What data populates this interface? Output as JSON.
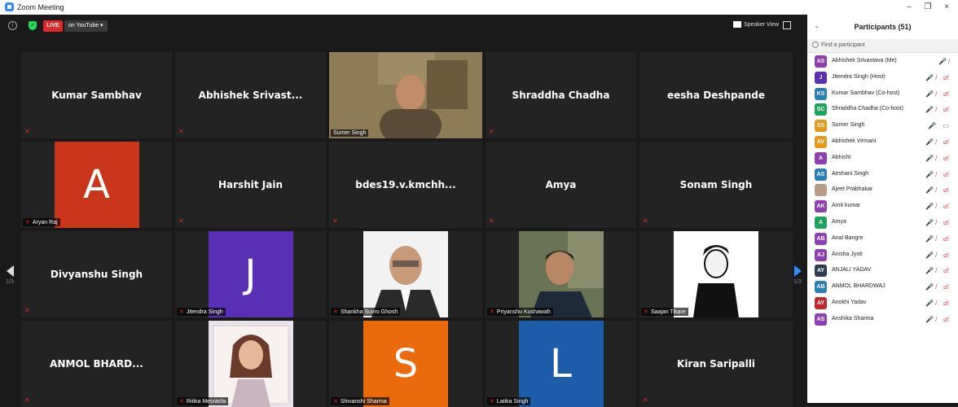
{
  "window": {
    "title": "Zoom Meeting",
    "minimize": "–",
    "restore": "❐",
    "close": "×"
  },
  "topbar": {
    "live": "LIVE",
    "stream": "on YouTube ▾",
    "speaker_view": "Speaker View"
  },
  "tiles": [
    {
      "name": "Kumar Sambhav",
      "muted": true
    },
    {
      "name": "Abhishek  Srivast...",
      "muted": true
    },
    {
      "label": "Sumer Singh",
      "type": "video",
      "active": true
    },
    {
      "name": "Shraddha Chadha",
      "muted": true
    },
    {
      "name": "eesha Deshpande",
      "muted": false
    },
    {
      "label": "Aryan Raj",
      "letter": "A",
      "color": "#c9361a"
    },
    {
      "name": "Harshit Jain",
      "muted": true
    },
    {
      "name": "bdes19.v.kmchh...",
      "muted": true
    },
    {
      "name": "Amya",
      "muted": true
    },
    {
      "name": "Sonam Singh",
      "muted": true
    },
    {
      "name": "Divyanshu Singh",
      "muted": true
    },
    {
      "label": "Jitendra Singh",
      "letter": "J",
      "color": "#5b2fb5"
    },
    {
      "label": "Shankha Suvro Ghosh",
      "type": "photo"
    },
    {
      "label": "Priyanshu Kushawah",
      "type": "photo"
    },
    {
      "label": "Saajan Tikare",
      "type": "photo"
    },
    {
      "name": "ANMOL  BHARD...",
      "muted": true
    },
    {
      "label": "Ritika Mesracta",
      "type": "photo"
    },
    {
      "label": "Shivanshi Sharma",
      "letter": "S",
      "color": "#ea6a0c"
    },
    {
      "label": "Latika Singh",
      "letter": "L",
      "color": "#1d5ca8"
    },
    {
      "name": "Kiran Saripalli",
      "muted": true
    }
  ],
  "nav": {
    "left_page": "1/3",
    "right_page": "1/3"
  },
  "participants": {
    "title": "Participants (51)",
    "search_placeholder": "Find a participant",
    "items": [
      {
        "initials": "AS",
        "name": "Abhishek Srivastava (Me)",
        "color": "#8e3fb1",
        "icons": "🎤̸"
      },
      {
        "initials": "J",
        "name": "Jitendra Singh (Host)",
        "color": "#5b2fb5",
        "icons": "🎤̸ ▭̸"
      },
      {
        "initials": "KS",
        "name": "Kumar Sambhav (Co-host)",
        "color": "#2a7fb8",
        "icons": "🎤̸ ▭̸"
      },
      {
        "initials": "SC",
        "name": "Shraddha Chadha (Co-host)",
        "color": "#1fa35a",
        "icons": "🎤̸ ▭̸"
      },
      {
        "initials": "SS",
        "name": "Sumer Singh",
        "color": "#e39a1c",
        "icons": "🎤 ▭"
      },
      {
        "initials": "AV",
        "name": "Abhishek Virmani",
        "color": "#e39a1c",
        "icons": "🎤̸ ▭̸"
      },
      {
        "initials": "A",
        "name": "Abhisht",
        "color": "#8e3fb1",
        "icons": "🎤̸ ▭̸"
      },
      {
        "initials": "AS",
        "name": "Aeshani Singh",
        "color": "#2a7fb8",
        "icons": "🎤̸ ▭̸"
      },
      {
        "initials": "",
        "name": "Ajeet Prabhakar",
        "color": "#b99c83",
        "icons": "🎤̸ ▭̸"
      },
      {
        "initials": "AK",
        "name": "Amit kumar",
        "color": "#8e3fb1",
        "icons": "🎤̸ ▭̸"
      },
      {
        "initials": "A",
        "name": "Amya",
        "color": "#1fa35a",
        "icons": "🎤̸ ▭̸"
      },
      {
        "initials": "AB",
        "name": "Anal Bangre",
        "color": "#8e3fb1",
        "icons": "🎤̸ ▭̸"
      },
      {
        "initials": "AJ",
        "name": "Anisha Jyoti",
        "color": "#8e3fb1",
        "icons": "🎤̸ ▭̸"
      },
      {
        "initials": "AY",
        "name": "ANJALI YADAV",
        "color": "#2f3b52",
        "icons": "🎤̸ ▭̸"
      },
      {
        "initials": "AB",
        "name": "ANMOL BHARDWAJ",
        "color": "#2a7fb8",
        "icons": "🎤̸ ▭̸"
      },
      {
        "initials": "AY",
        "name": "Anokhi Yadav",
        "color": "#c0282d",
        "icons": "🎤̸ ▭̸"
      },
      {
        "initials": "AS",
        "name": "Anshika Sharma",
        "color": "#8e3fb1",
        "icons": "🎤̸ ▭̸"
      }
    ]
  }
}
